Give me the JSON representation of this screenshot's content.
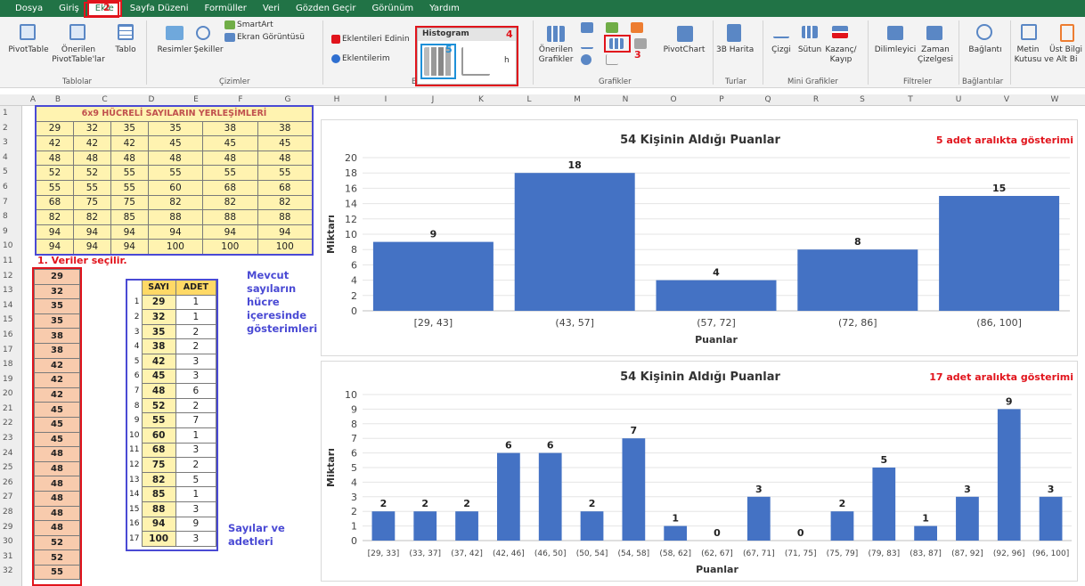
{
  "ribbon_tabs": [
    "Dosya",
    "Giriş",
    "Ekle",
    "Sayfa Düzeni",
    "Formüller",
    "Veri",
    "Gözden Geçir",
    "Görünüm",
    "Yardım"
  ],
  "ribbon": {
    "pivottable": "PivotTable",
    "recommended_pivot": "Önerilen",
    "recommended_pivot2": "PivotTable'lar",
    "table": "Tablo",
    "pictures": "Resimler",
    "shapes": "Şekiller",
    "smartart": "SmartArt",
    "screenshot": "Ekran Görüntüsü",
    "get_addins": "Eklentileri Edinin",
    "my_addins": "Eklentilerim",
    "histogram": "Histogram",
    "recommended_charts": "Önerilen",
    "recommended_charts2": "Grafikler",
    "pivotchart": "PivotChart",
    "map3d": "3B Harita",
    "line": "Çizgi",
    "column": "Sütun",
    "winloss": "Kazanç/",
    "winloss2": "Kayıp",
    "slicer": "Dilimleyici",
    "timeline": "Zaman",
    "timeline2": "Çizelgesi",
    "link": "Bağlantı",
    "textbox": "Metin",
    "textbox2": "Kutusu",
    "header": "Üst Bilgi",
    "header2": "ve Alt Bi",
    "groups": {
      "tables": "Tablolar",
      "illustrations": "Çizimler",
      "addins": "Eklentiler",
      "charts": "Grafikler",
      "tours": "Turlar",
      "sparklines": "Mini Grafikler",
      "filters": "Filtreler",
      "links": "Bağlantılar"
    },
    "markers": [
      "2",
      "4",
      "5",
      "3"
    ]
  },
  "columns": [
    "A",
    "B",
    "C",
    "D",
    "E",
    "F",
    "G",
    "H",
    "I",
    "J",
    "K",
    "L",
    "M",
    "N",
    "O",
    "P",
    "Q",
    "R",
    "S",
    "T",
    "U",
    "V",
    "W"
  ],
  "rows": [
    "1",
    "2",
    "3",
    "4",
    "5",
    "6",
    "7",
    "8",
    "9",
    "10",
    "11",
    "12",
    "13",
    "14",
    "15",
    "16",
    "17",
    "18",
    "19",
    "20",
    "21",
    "22",
    "23",
    "24",
    "25",
    "26",
    "27",
    "28",
    "29",
    "30",
    "31",
    "32"
  ],
  "grid_title": "6x9 HÜCRELİ SAYILARIN YERLEŞİMLERİ",
  "grid": [
    [
      "29",
      "32",
      "35",
      "35",
      "38",
      "38"
    ],
    [
      "42",
      "42",
      "42",
      "45",
      "45",
      "45"
    ],
    [
      "48",
      "48",
      "48",
      "48",
      "48",
      "48"
    ],
    [
      "52",
      "52",
      "55",
      "55",
      "55",
      "55"
    ],
    [
      "55",
      "55",
      "55",
      "60",
      "68",
      "68"
    ],
    [
      "68",
      "75",
      "75",
      "82",
      "82",
      "82"
    ],
    [
      "82",
      "82",
      "85",
      "88",
      "88",
      "88"
    ],
    [
      "94",
      "94",
      "94",
      "94",
      "94",
      "94"
    ],
    [
      "94",
      "94",
      "94",
      "100",
      "100",
      "100"
    ]
  ],
  "note_selected": "1. Veriler seçilir.",
  "data_column": [
    "29",
    "32",
    "35",
    "35",
    "38",
    "38",
    "42",
    "42",
    "42",
    "45",
    "45",
    "45",
    "48",
    "48",
    "48",
    "48",
    "48",
    "48",
    "52",
    "52",
    "55"
  ],
  "freq_header": [
    "SAYI",
    "ADET"
  ],
  "freq_rows": [
    [
      "1",
      "29",
      "1"
    ],
    [
      "2",
      "32",
      "1"
    ],
    [
      "3",
      "35",
      "2"
    ],
    [
      "4",
      "38",
      "2"
    ],
    [
      "5",
      "42",
      "3"
    ],
    [
      "6",
      "45",
      "3"
    ],
    [
      "7",
      "48",
      "6"
    ],
    [
      "8",
      "52",
      "2"
    ],
    [
      "9",
      "55",
      "7"
    ],
    [
      "10",
      "60",
      "1"
    ],
    [
      "11",
      "68",
      "3"
    ],
    [
      "12",
      "75",
      "2"
    ],
    [
      "13",
      "82",
      "5"
    ],
    [
      "14",
      "85",
      "1"
    ],
    [
      "15",
      "88",
      "3"
    ],
    [
      "16",
      "94",
      "9"
    ],
    [
      "17",
      "100",
      "3"
    ]
  ],
  "note_cells": [
    "Mevcut",
    "sayıların",
    "hücre",
    "içeresinde",
    "gösterimleri"
  ],
  "note_counts": [
    "Sayılar ve",
    "adetleri"
  ],
  "chart_data": [
    {
      "type": "bar",
      "title": "54 Kişinin Aldığı Puanlar",
      "note": "5 adet aralıkta gösterimi",
      "categories": [
        "[29, 43]",
        "(43, 57]",
        "(57, 72]",
        "(72, 86]",
        "(86, 100]"
      ],
      "values": [
        9,
        18,
        4,
        8,
        15
      ],
      "xlabel": "Puanlar",
      "ylabel": "Miktarı",
      "ylim": [
        0,
        20
      ],
      "yticks": [
        "0",
        "2",
        "4",
        "6",
        "8",
        "10",
        "12",
        "14",
        "16",
        "18",
        "20"
      ],
      "color": "#4472c4"
    },
    {
      "type": "bar",
      "title": "54 Kişinin Aldığı Puanlar",
      "note": "17 adet aralıkta gösterimi",
      "categories": [
        "[29, 33]",
        "(33, 37]",
        "(37, 42]",
        "(42, 46]",
        "(46, 50]",
        "(50, 54]",
        "(54, 58]",
        "(58, 62]",
        "(62, 67]",
        "(67, 71]",
        "(71, 75]",
        "(75, 79]",
        "(79, 83]",
        "(83, 87]",
        "(87, 92]",
        "(92, 96]",
        "(96, 100]"
      ],
      "values": [
        2,
        2,
        2,
        6,
        6,
        2,
        7,
        1,
        0,
        3,
        0,
        2,
        5,
        1,
        3,
        9,
        3
      ],
      "xlabel": "Puanlar",
      "ylabel": "Miktarı",
      "ylim": [
        0,
        10
      ],
      "yticks": [
        "0",
        "1",
        "2",
        "3",
        "4",
        "5",
        "6",
        "7",
        "8",
        "9",
        "10"
      ],
      "color": "#4472c4"
    }
  ]
}
